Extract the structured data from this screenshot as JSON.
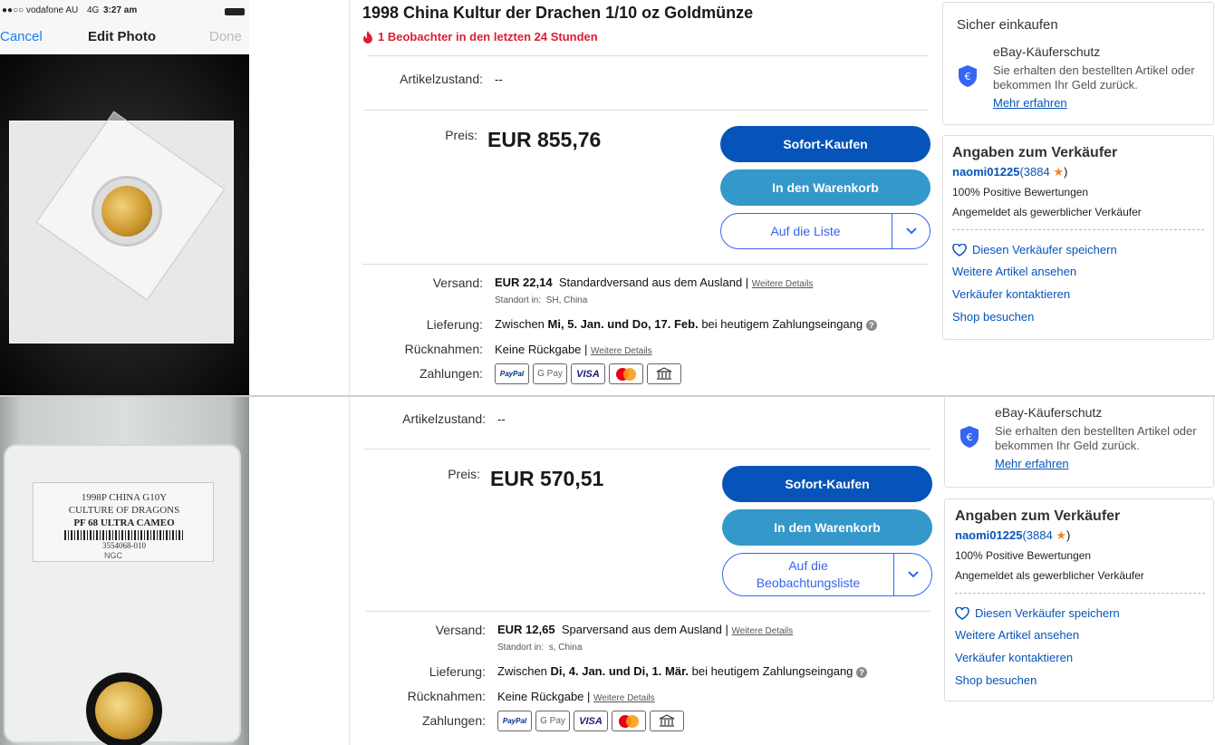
{
  "phone": {
    "carrier": "●●○○ vodafone AU",
    "network": "4G",
    "time": "3:27 am",
    "cancel": "Cancel",
    "title": "Edit Photo",
    "done": "Done"
  },
  "slab": {
    "line1": "1998P CHINA G10Y",
    "line2": "CULTURE OF DRAGONS",
    "line3": "PF 68 ULTRA CAMEO",
    "cert": "3554068-010",
    "brand": "NGC"
  },
  "listings": [
    {
      "title": "1998 China Kultur der Drachen 1/10 oz Goldmünze",
      "watchers": "1 Beobachter in den letzten 24 Stunden",
      "condition_label": "Artikelzustand:",
      "condition_value": "--",
      "price_label": "Preis:",
      "price": "EUR 855,76",
      "buy_label": "Sofort-Kaufen",
      "cart_label": "In den Warenkorb",
      "list_label": "Auf die Liste",
      "shipping_label": "Versand:",
      "shipping_cost": "EUR 22,14",
      "shipping_method": "Standardversand aus dem Ausland",
      "details_link": "Weitere Details",
      "location_label": "Standort in:",
      "location_value": "SH, China",
      "delivery_label": "Lieferung:",
      "delivery_pre": "Zwischen",
      "delivery_dates": "Mi, 5. Jan. und Do, 17. Feb.",
      "delivery_post": "bei heutigem Zahlungseingang",
      "returns_label": "Rücknahmen:",
      "returns_value": "Keine Rückgabe",
      "payments_label": "Zahlungen:"
    },
    {
      "condition_label": "Artikelzustand:",
      "condition_value": "--",
      "price_label": "Preis:",
      "price": "EUR 570,51",
      "buy_label": "Sofort-Kaufen",
      "cart_label": "In den Warenkorb",
      "list_label": "Auf die Beobachtungsliste",
      "shipping_label": "Versand:",
      "shipping_cost": "EUR 12,65",
      "shipping_method": "Sparversand aus dem Ausland",
      "details_link": "Weitere Details",
      "location_label": "Standort in:",
      "location_value": "s, China",
      "delivery_label": "Lieferung:",
      "delivery_pre": "Zwischen",
      "delivery_dates": "Di, 4. Jan. und Di, 1. Mär.",
      "delivery_post": "bei heutigem Zahlungseingang",
      "returns_label": "Rücknahmen:",
      "returns_value": "Keine Rückgabe",
      "payments_label": "Zahlungen:"
    }
  ],
  "payment_methods": [
    "PayPal",
    "G Pay",
    "VISA",
    "Mastercard",
    "Bank"
  ],
  "safe_buying": {
    "title": "Sicher einkaufen",
    "protection": "eBay-Käuferschutz",
    "desc": "Sie erhalten den bestellten Artikel oder bekommen Ihr Geld zurück.",
    "link": "Mehr erfahren"
  },
  "seller": {
    "heading": "Angaben zum Verkäufer",
    "name": "naomi01225",
    "score": "3884",
    "positive": "100% Positive Bewertungen",
    "registered": "Angemeldet als gewerblicher Verkäufer",
    "save": "Diesen Verkäufer speichern",
    "more_items": "Weitere Artikel ansehen",
    "contact": "Verkäufer kontaktieren",
    "shop": "Shop besuchen"
  },
  "colors": {
    "primary": "#0654ba",
    "secondary": "#3498ca",
    "alert": "#dd1e31",
    "star": "#f5861f"
  }
}
